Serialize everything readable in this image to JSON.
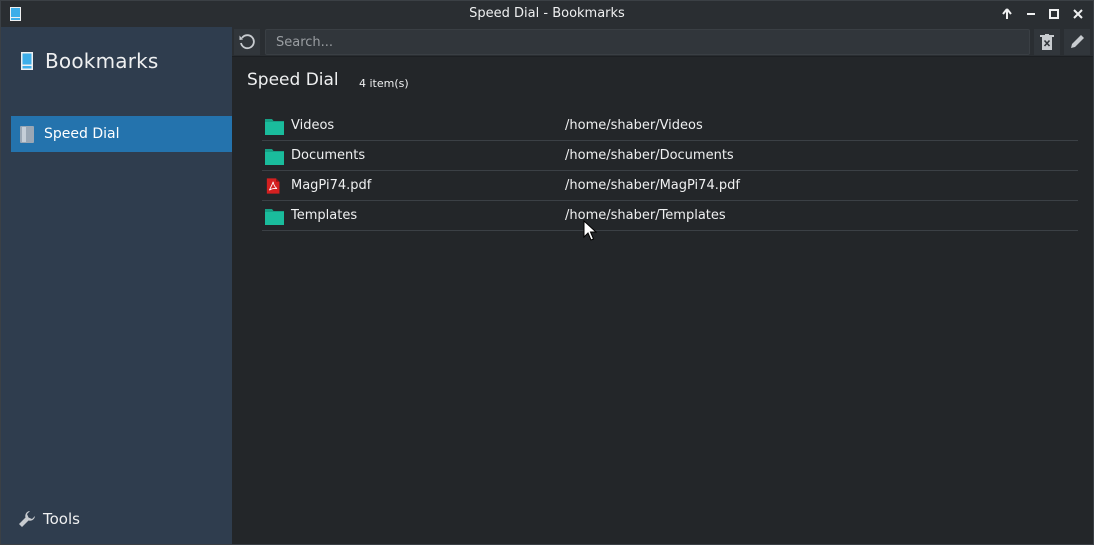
{
  "window": {
    "title": "Speed Dial - Bookmarks",
    "controls": [
      "keep-above",
      "minimize",
      "maximize",
      "close"
    ]
  },
  "sidebar": {
    "brand_label": "Bookmarks",
    "items": [
      {
        "label": "Speed Dial",
        "icon": "bookmark-book-icon",
        "selected": true
      }
    ],
    "footer_label": "Tools",
    "footer_icon": "wrench-icon"
  },
  "toolbar": {
    "reload_icon": "reload-icon",
    "search_placeholder": "Search...",
    "search_value": "",
    "clear_icon": "trash-icon",
    "edit_icon": "pencil-icon"
  },
  "main": {
    "heading": "Speed Dial",
    "count_label": "4 item(s)",
    "rows": [
      {
        "name": "Videos",
        "path": "/home/shaber/Videos",
        "icon": "folder-icon"
      },
      {
        "name": "Documents",
        "path": "/home/shaber/Documents",
        "icon": "folder-icon"
      },
      {
        "name": "MagPi74.pdf",
        "path": "/home/shaber/MagPi74.pdf",
        "icon": "pdf-icon"
      },
      {
        "name": "Templates",
        "path": "/home/shaber/Templates",
        "icon": "folder-icon"
      }
    ]
  },
  "colors": {
    "accent": "#2473ad",
    "folder": "#1abc9c",
    "pdf": "#d42020",
    "sidebar_bg": "#2f3d4e",
    "content_bg": "#232629"
  }
}
